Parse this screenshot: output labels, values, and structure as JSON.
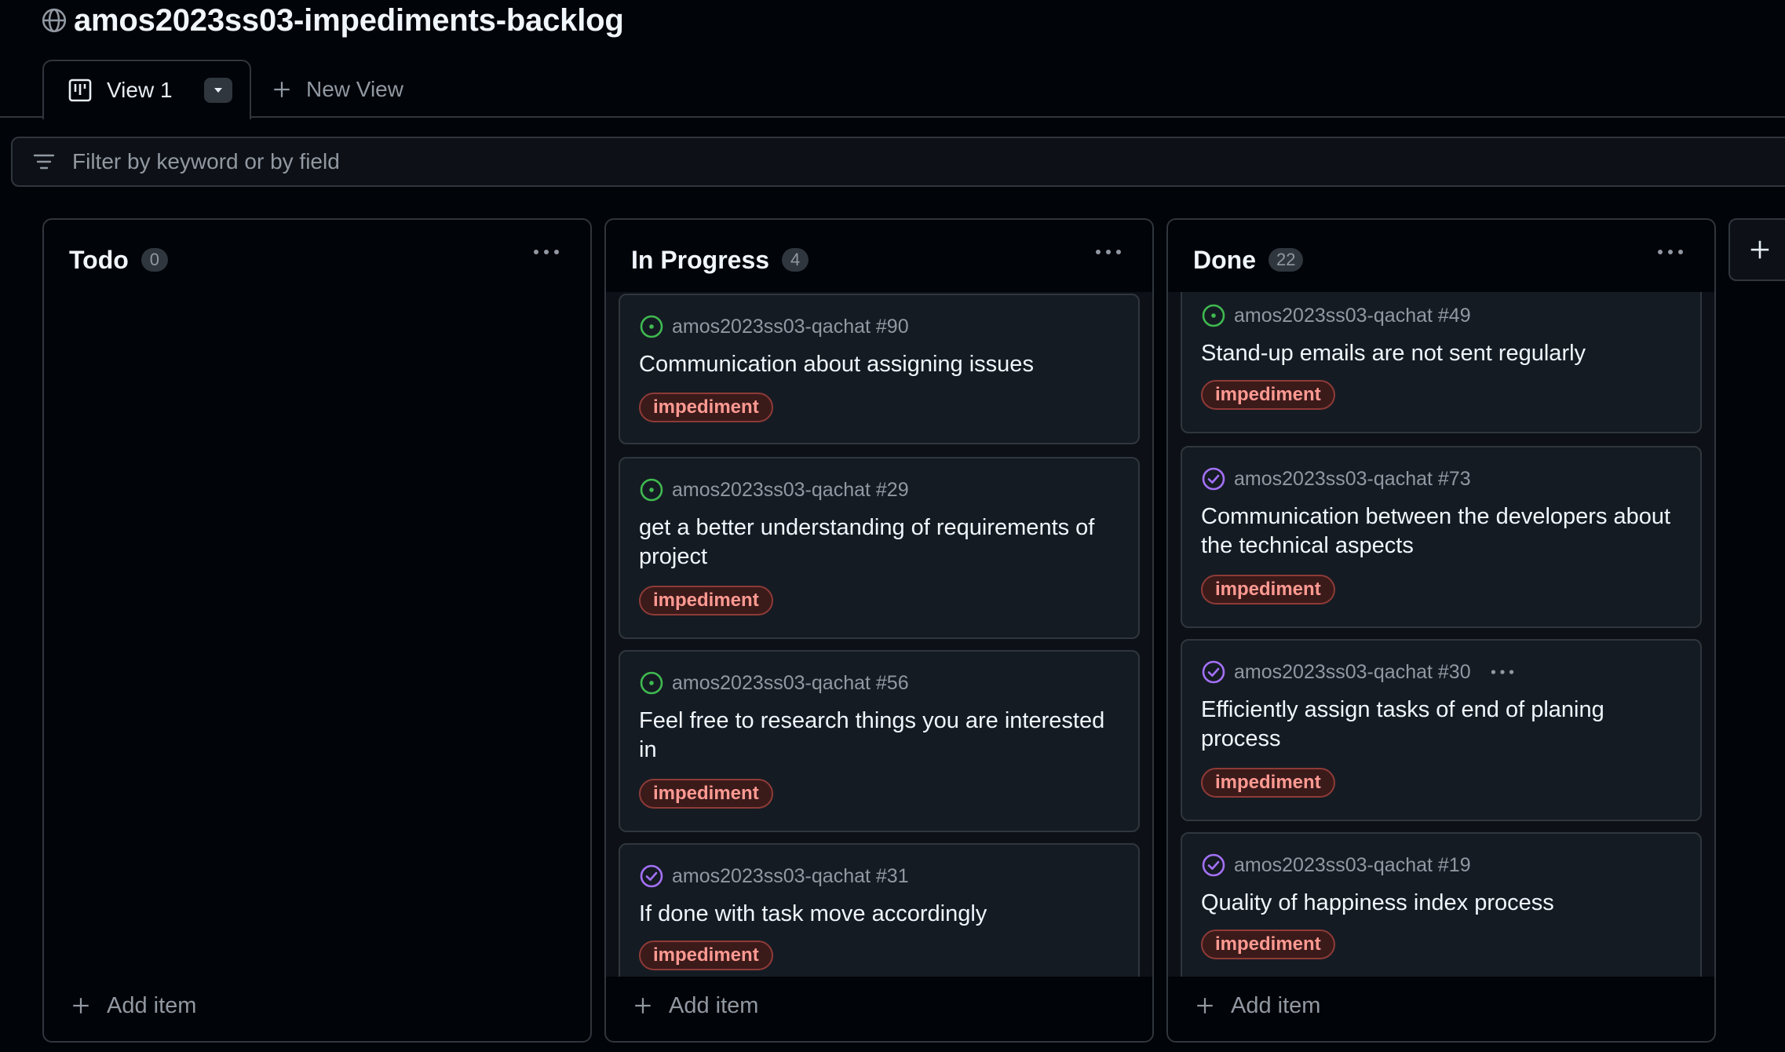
{
  "project": {
    "title": "amos2023ss03-impediments-backlog"
  },
  "tabs": {
    "active_label": "View 1",
    "new_view_label": "New View"
  },
  "filter": {
    "placeholder": "Filter by keyword or by field"
  },
  "columns": [
    {
      "title": "Todo",
      "count": "0",
      "add_item_label": "Add item",
      "cards": []
    },
    {
      "title": "In Progress",
      "count": "4",
      "add_item_label": "Add item",
      "cards": [
        {
          "ref": "amos2023ss03-qachat #90",
          "status": "open",
          "title": "Communication about assigning issues",
          "label": "impediment"
        },
        {
          "ref": "amos2023ss03-qachat #29",
          "status": "open",
          "title": "get a better understanding of requirements of project",
          "label": "impediment"
        },
        {
          "ref": "amos2023ss03-qachat #56",
          "status": "open",
          "title": "Feel free to research things you are interested in",
          "label": "impediment"
        },
        {
          "ref": "amos2023ss03-qachat #31",
          "status": "closed",
          "title": "If done with task move accordingly",
          "label": "impediment"
        }
      ]
    },
    {
      "title": "Done",
      "count": "22",
      "add_item_label": "Add item",
      "cards": [
        {
          "ref": "amos2023ss03-qachat #49",
          "status": "open",
          "title": "Stand-up emails are not sent regularly",
          "label": "impediment"
        },
        {
          "ref": "amos2023ss03-qachat #73",
          "status": "closed",
          "title": "Communication between the developers about the technical aspects",
          "label": "impediment"
        },
        {
          "ref": "amos2023ss03-qachat #30",
          "status": "closed",
          "title": "Efficiently assign tasks of end of planing process",
          "label": "impediment"
        },
        {
          "ref": "amos2023ss03-qachat #19",
          "status": "closed",
          "title": "Quality of happiness index process",
          "label": "impediment"
        }
      ]
    }
  ],
  "colors": {
    "open_issue": "#3fb950",
    "closed_issue": "#a371f7",
    "label_text": "#ff9a92",
    "label_border": "#8e3b37"
  }
}
